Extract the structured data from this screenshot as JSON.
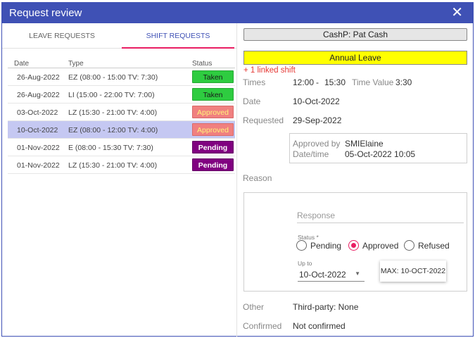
{
  "window": {
    "title": "Request review",
    "close_glyph": "✕",
    "accent": "#3f51b5"
  },
  "tabs": [
    {
      "label": "LEAVE REQUESTS",
      "active": false
    },
    {
      "label": "SHIFT REQUESTS",
      "active": true
    }
  ],
  "table": {
    "headers": {
      "date": "Date",
      "type": "Type",
      "status": "Status"
    },
    "rows": [
      {
        "date": "26-Aug-2022",
        "type": "EZ (08:00 - 15:00 TV: 7:30)",
        "status": "Taken",
        "selected": false
      },
      {
        "date": "26-Aug-2022",
        "type": "LI (15:00 - 22:00 TV: 7:00)",
        "status": "Taken",
        "selected": false
      },
      {
        "date": "03-Oct-2022",
        "type": "LZ (15:30 - 21:00 TV: 4:00)",
        "status": "Approved",
        "selected": false
      },
      {
        "date": "10-Oct-2022",
        "type": "EZ (08:00 - 12:00 TV: 4:00)",
        "status": "Approved",
        "selected": true
      },
      {
        "date": "01-Nov-2022",
        "type": "E (08:00 - 15:30 TV: 7:30)",
        "status": "Pending",
        "selected": false
      },
      {
        "date": "01-Nov-2022",
        "type": "LZ (15:30 - 21:00 TV: 4:00)",
        "status": "Pending",
        "selected": false
      }
    ]
  },
  "detail": {
    "cash_button": "CashP: Pat Cash",
    "leave_type": "Annual Leave",
    "linked": "+ 1 linked shift",
    "times": {
      "label": "Times",
      "start": "12:00",
      "sep": "-",
      "end": "15:30",
      "tv_label": "Time Value",
      "tv": "3:30"
    },
    "date": {
      "label": "Date",
      "value": "10-Oct-2022"
    },
    "requested": {
      "label": "Requested",
      "value": "29-Sep-2022"
    },
    "approval": {
      "by_label": "Approved by",
      "by_value": "SMIElaine",
      "dt_label": "Date/time",
      "dt_value": "05-Oct-2022 10:05"
    },
    "reason": {
      "label": "Reason"
    },
    "response": {
      "placeholder": "Response",
      "status_label": "Status *",
      "options": [
        {
          "label": "Pending",
          "checked": false
        },
        {
          "label": "Approved",
          "checked": true
        },
        {
          "label": "Refused",
          "checked": false
        }
      ],
      "upto_label": "Up to",
      "upto_value": "10-Oct-2022",
      "max_tip": "MAX: 10-OCT-2022"
    },
    "other": {
      "label": "Other",
      "value": "Third-party: None"
    },
    "confirmed": {
      "label": "Confirmed",
      "value": "Not confirmed"
    }
  }
}
